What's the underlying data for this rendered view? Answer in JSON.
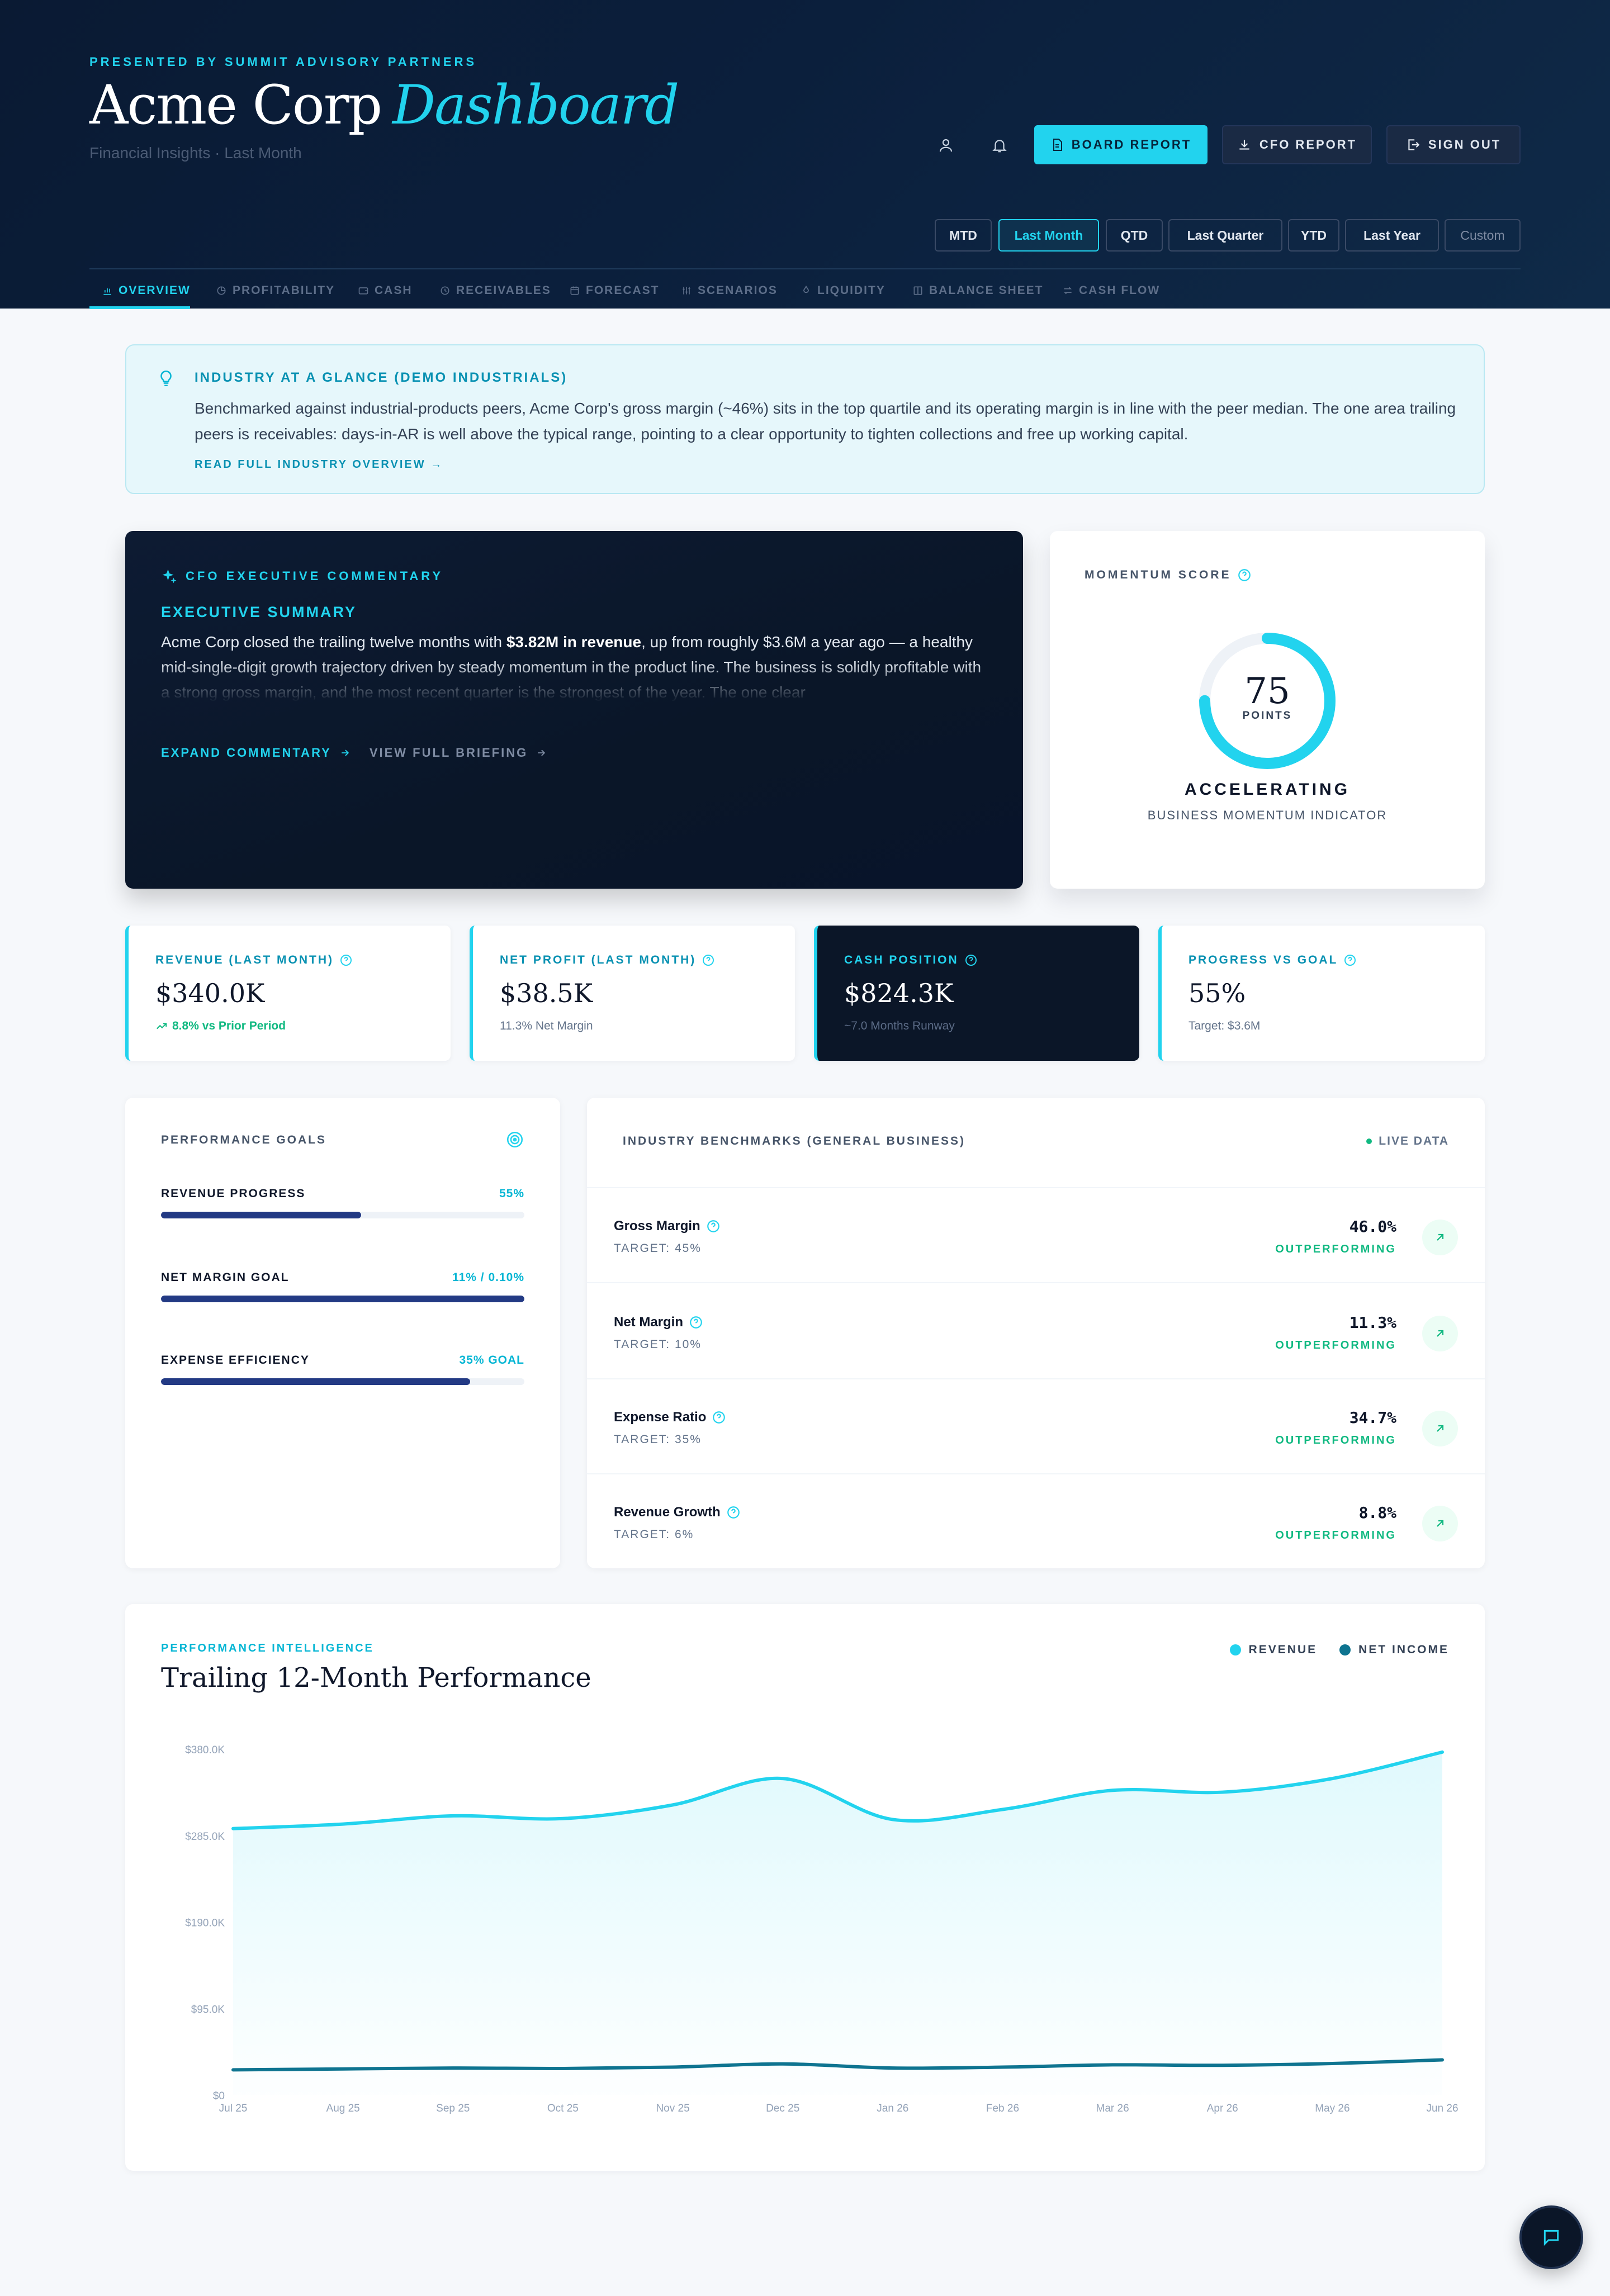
{
  "header": {
    "presented_by": "PRESENTED BY SUMMIT ADVISORY PARTNERS",
    "company": "Acme Corp",
    "dashboard_word": "Dashboard",
    "subtitle": "Financial Insights · Last Month",
    "buttons": {
      "board_report": "BOARD REPORT",
      "cfo_report": "CFO REPORT",
      "sign_out": "SIGN OUT"
    },
    "periods": [
      "MTD",
      "Last Month",
      "QTD",
      "Last Quarter",
      "YTD",
      "Last Year",
      "Custom"
    ],
    "active_period": "Last Month",
    "tabs": [
      "OVERVIEW",
      "PROFITABILITY",
      "CASH",
      "RECEIVABLES",
      "FORECAST",
      "SCENARIOS",
      "LIQUIDITY",
      "BALANCE SHEET",
      "CASH FLOW"
    ],
    "active_tab": "OVERVIEW"
  },
  "industry": {
    "title": "INDUSTRY AT A GLANCE (DEMO INDUSTRIALS)",
    "body": "Benchmarked against industrial-products peers, Acme Corp's gross margin (~46%) sits in the top quartile and its operating margin is in line with the peer median. The one area trailing peers is receivables: days-in-AR is well above the typical range, pointing to a clear opportunity to tighten collections and free up working capital.",
    "link": "READ FULL INDUSTRY OVERVIEW →"
  },
  "cfo": {
    "label": "CFO EXECUTIVE COMMENTARY",
    "summary_title": "EXECUTIVE SUMMARY",
    "body_pre": "Acme Corp closed the trailing twelve months with ",
    "body_bold": "$3.82M in revenue",
    "body_post": ", up from roughly $3.6M a year ago — a healthy mid-single-digit growth trajectory driven by steady momentum in the product line. The business is solidly profitable with a strong gross margin, and the most recent quarter is the strongest of the year. The one clear",
    "expand": "EXPAND COMMENTARY",
    "view": "VIEW FULL BRIEFING"
  },
  "momentum": {
    "label": "MOMENTUM SCORE",
    "score": "75",
    "score_value": 75,
    "points_label": "POINTS",
    "state": "ACCELERATING",
    "description": "BUSINESS MOMENTUM INDICATOR"
  },
  "kpis": [
    {
      "label": "REVENUE (LAST MONTH)",
      "value": "$340.0K",
      "sub": "8.8% vs Prior Period",
      "trend": "up"
    },
    {
      "label": "NET PROFIT (LAST MONTH)",
      "value": "$38.5K",
      "sub": "11.3% Net Margin"
    },
    {
      "label": "CASH POSITION",
      "value": "$824.3K",
      "sub": "~7.0 Months Runway",
      "dark": true
    },
    {
      "label": "PROGRESS VS GOAL",
      "value": "55%",
      "sub": "Target: $3.6M"
    }
  ],
  "goals": {
    "title": "PERFORMANCE GOALS",
    "items": [
      {
        "name": "REVENUE PROGRESS",
        "display": "55%",
        "progress": 0.55
      },
      {
        "name": "NET MARGIN GOAL",
        "display": "11% / 0.10%",
        "progress": 1.0
      },
      {
        "name": "EXPENSE EFFICIENCY",
        "display": "35% GOAL",
        "progress": 0.85
      }
    ]
  },
  "benchmarks": {
    "title": "INDUSTRY BENCHMARKS (GENERAL BUSINESS)",
    "live": "LIVE DATA",
    "rows": [
      {
        "name": "Gross Margin",
        "target": "TARGET: 45%",
        "value": "46.0%",
        "status": "OUTPERFORMING"
      },
      {
        "name": "Net Margin",
        "target": "TARGET: 10%",
        "value": "11.3%",
        "status": "OUTPERFORMING"
      },
      {
        "name": "Expense Ratio",
        "target": "TARGET: 35%",
        "value": "34.7%",
        "status": "OUTPERFORMING"
      },
      {
        "name": "Revenue Growth",
        "target": "TARGET: 6%",
        "value": "8.8%",
        "status": "OUTPERFORMING"
      }
    ]
  },
  "performance": {
    "eyebrow": "PERFORMANCE INTELLIGENCE",
    "title": "Trailing 12-Month Performance"
  },
  "colors": {
    "accent": "#22d3ee",
    "navy": "#0b1628",
    "success": "#10b981",
    "net_income": "#0e7490"
  },
  "chart_data": {
    "type": "area",
    "title": "Trailing 12-Month Performance",
    "categories": [
      "Jul 25",
      "Aug 25",
      "Sep 25",
      "Oct 25",
      "Nov 25",
      "Dec 25",
      "Jan 26",
      "Feb 26",
      "Mar 26",
      "Apr 26",
      "May 26",
      "Jun 26"
    ],
    "y_ticks": [
      "$0",
      "$95.0K",
      "$190.0K",
      "$285.0K",
      "$380.0K"
    ],
    "ylim": [
      0,
      380000
    ],
    "grid": false,
    "legend_position": "top-right",
    "series": [
      {
        "name": "REVENUE",
        "color": "#22d3ee",
        "values": [
          293000,
          298000,
          307000,
          304000,
          319000,
          348000,
          303000,
          314000,
          335000,
          333000,
          348000,
          377000
        ]
      },
      {
        "name": "NET INCOME",
        "color": "#0e7490",
        "values": [
          28000,
          29000,
          30000,
          29500,
          31000,
          34500,
          30000,
          31000,
          33500,
          33000,
          35000,
          39000
        ]
      }
    ]
  }
}
